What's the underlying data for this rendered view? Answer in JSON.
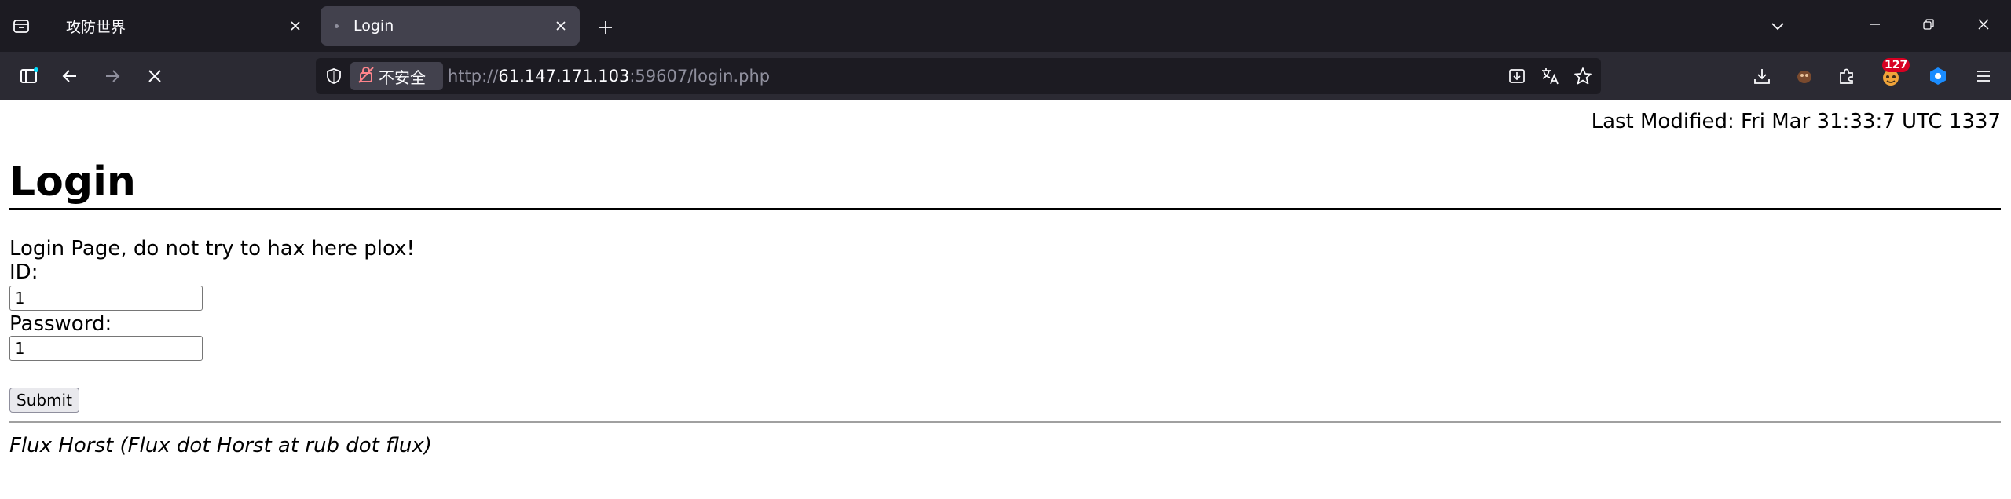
{
  "tabs": [
    {
      "title": "攻防世界",
      "active": false
    },
    {
      "title": "Login",
      "active": true
    }
  ],
  "toolbar": {
    "security_label": "不安全",
    "url_scheme": "http://",
    "url_host": "61.147.171.103",
    "url_rest": ":59607/login.php",
    "extension_badge": "127"
  },
  "icons": [
    "tab-list-icon",
    "tab-close-icon",
    "new-tab-icon",
    "list-all-tabs-icon",
    "minimize-icon",
    "restore-icon",
    "window-close-icon",
    "sidebar-icon",
    "back-icon",
    "forward-icon",
    "stop-icon",
    "shield-icon",
    "broken-lock-icon",
    "install-app-icon",
    "translate-icon",
    "bookmark-star-icon",
    "downloads-icon",
    "extension-icon",
    "extensions-puzzle-icon",
    "menu-icon"
  ],
  "page": {
    "last_modified": "Last Modified: Fri Mar 31:33:7 UTC 1337",
    "title": "Login",
    "intro": "Login Page, do not try to hax here plox!",
    "id_label": "ID:",
    "id_value": "1",
    "password_label": "Password:",
    "password_value": "1",
    "submit_label": "Submit",
    "footer": "Flux Horst (Flux dot Horst at rub dot flux)"
  },
  "colors": {
    "tabbar_bg": "#1c1b22",
    "toolbar_bg": "#2b2a33",
    "active_tab_bg": "#42414d",
    "badge_bg": "#d70022",
    "url_dim": "#8f8f9d"
  }
}
